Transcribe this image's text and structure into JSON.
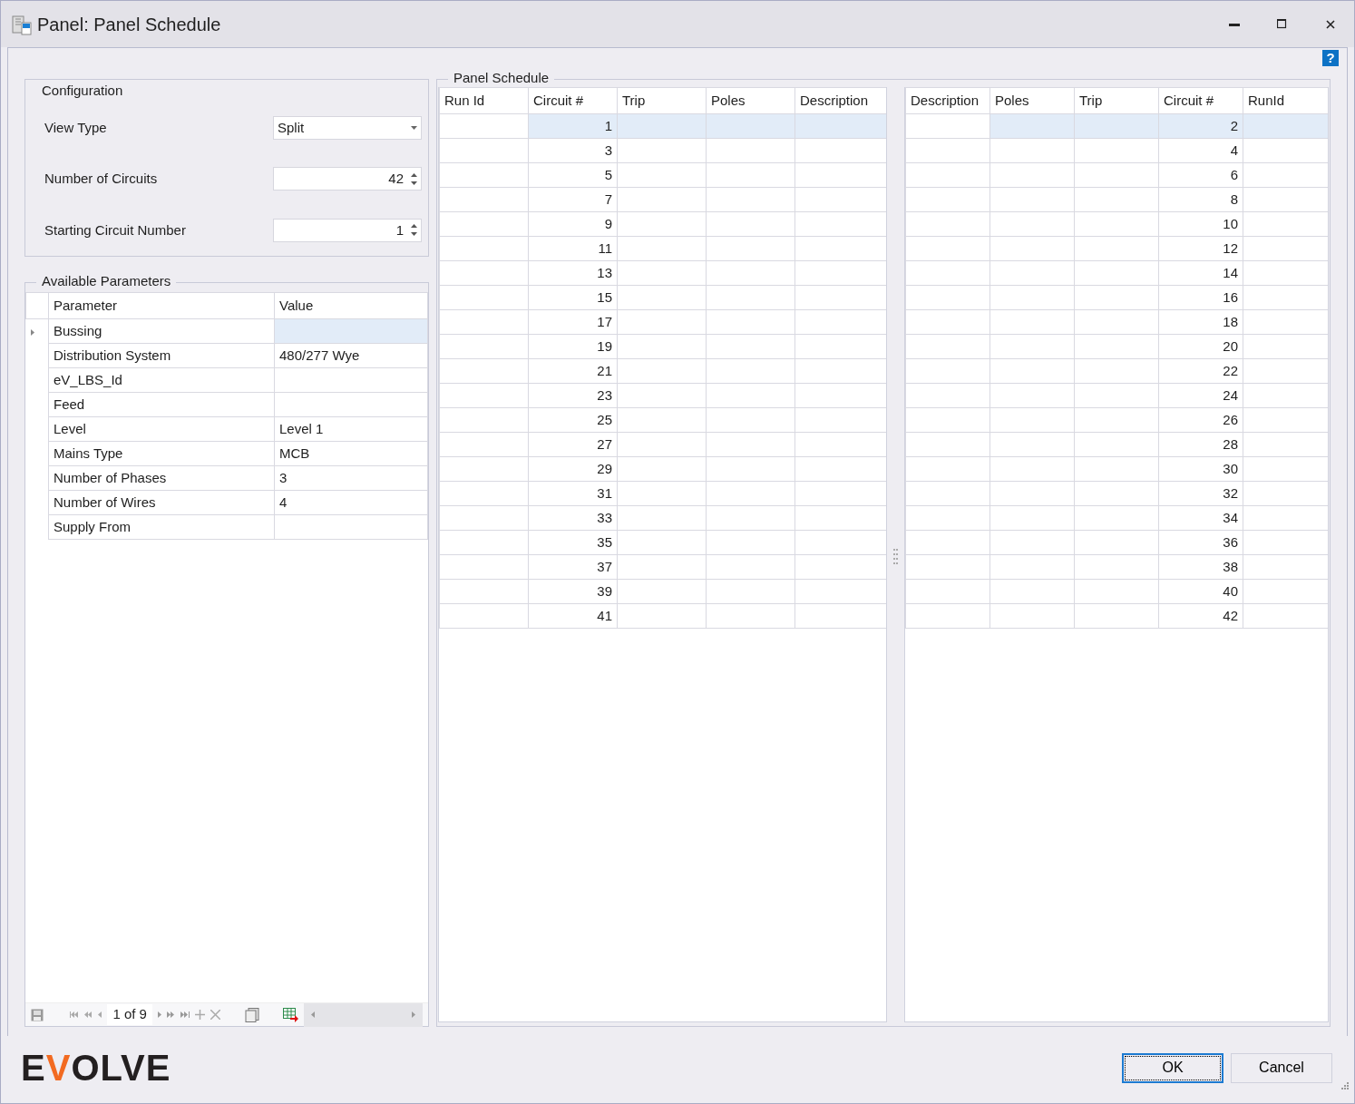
{
  "window": {
    "title": "Panel: Panel Schedule"
  },
  "help": "?",
  "configuration": {
    "title": "Configuration",
    "fields": [
      {
        "label": "View Type",
        "kind": "dropdown",
        "value": "Split"
      },
      {
        "label": "Number of Circuits",
        "kind": "spin",
        "value": "42"
      },
      {
        "label": "Starting Circuit Number",
        "kind": "spin",
        "value": "1"
      }
    ]
  },
  "parameters": {
    "title": "Available Parameters",
    "columns": [
      "Parameter",
      "Value"
    ],
    "rows": [
      {
        "name": "Bussing",
        "value": "",
        "selected": true,
        "expandable": true
      },
      {
        "name": "Distribution System",
        "value": "480/277 Wye",
        "selected": false,
        "expandable": false
      },
      {
        "name": "eV_LBS_Id",
        "value": "",
        "selected": false,
        "expandable": false
      },
      {
        "name": "Feed",
        "value": "",
        "selected": false,
        "expandable": false
      },
      {
        "name": "Level",
        "value": "Level 1",
        "selected": false,
        "expandable": false
      },
      {
        "name": "Mains Type",
        "value": "MCB",
        "selected": false,
        "expandable": false
      },
      {
        "name": "Number of Phases",
        "value": "3",
        "selected": false,
        "expandable": false
      },
      {
        "name": "Number of Wires",
        "value": "4",
        "selected": false,
        "expandable": false
      },
      {
        "name": "Supply From",
        "value": "",
        "selected": false,
        "expandable": false
      }
    ],
    "navigator": {
      "position": "1 of 9"
    }
  },
  "schedule": {
    "title": "Panel Schedule",
    "left": {
      "columns": [
        {
          "label": "Run Id",
          "kind": "plain"
        },
        {
          "label": "Circuit #",
          "kind": "circuit"
        },
        {
          "label": "Trip",
          "kind": "plain"
        },
        {
          "label": "Poles",
          "kind": "plain"
        },
        {
          "label": "Description",
          "kind": "plain"
        }
      ],
      "rows": [
        {
          "circuit": "1",
          "selected": true
        },
        {
          "circuit": "3",
          "selected": false
        },
        {
          "circuit": "5",
          "selected": false
        },
        {
          "circuit": "7",
          "selected": false
        },
        {
          "circuit": "9",
          "selected": false
        },
        {
          "circuit": "11",
          "selected": false
        },
        {
          "circuit": "13",
          "selected": false
        },
        {
          "circuit": "15",
          "selected": false
        },
        {
          "circuit": "17",
          "selected": false
        },
        {
          "circuit": "19",
          "selected": false
        },
        {
          "circuit": "21",
          "selected": false
        },
        {
          "circuit": "23",
          "selected": false
        },
        {
          "circuit": "25",
          "selected": false
        },
        {
          "circuit": "27",
          "selected": false
        },
        {
          "circuit": "29",
          "selected": false
        },
        {
          "circuit": "31",
          "selected": false
        },
        {
          "circuit": "33",
          "selected": false
        },
        {
          "circuit": "35",
          "selected": false
        },
        {
          "circuit": "37",
          "selected": false
        },
        {
          "circuit": "39",
          "selected": false
        },
        {
          "circuit": "41",
          "selected": false
        }
      ]
    },
    "right": {
      "columns": [
        {
          "label": "Description",
          "kind": "plain"
        },
        {
          "label": "Poles",
          "kind": "plain"
        },
        {
          "label": "Trip",
          "kind": "plain"
        },
        {
          "label": "Circuit #",
          "kind": "circuit"
        },
        {
          "label": "RunId",
          "kind": "plain"
        }
      ],
      "rows": [
        {
          "circuit": "2",
          "selected": true
        },
        {
          "circuit": "4",
          "selected": false
        },
        {
          "circuit": "6",
          "selected": false
        },
        {
          "circuit": "8",
          "selected": false
        },
        {
          "circuit": "10",
          "selected": false
        },
        {
          "circuit": "12",
          "selected": false
        },
        {
          "circuit": "14",
          "selected": false
        },
        {
          "circuit": "16",
          "selected": false
        },
        {
          "circuit": "18",
          "selected": false
        },
        {
          "circuit": "20",
          "selected": false
        },
        {
          "circuit": "22",
          "selected": false
        },
        {
          "circuit": "24",
          "selected": false
        },
        {
          "circuit": "26",
          "selected": false
        },
        {
          "circuit": "28",
          "selected": false
        },
        {
          "circuit": "30",
          "selected": false
        },
        {
          "circuit": "32",
          "selected": false
        },
        {
          "circuit": "34",
          "selected": false
        },
        {
          "circuit": "36",
          "selected": false
        },
        {
          "circuit": "38",
          "selected": false
        },
        {
          "circuit": "40",
          "selected": false
        },
        {
          "circuit": "42",
          "selected": false
        }
      ]
    }
  },
  "logo": "EVOLVE",
  "buttons": [
    {
      "label": "OK",
      "kind": "default"
    },
    {
      "label": "Cancel",
      "kind": "normal"
    }
  ]
}
